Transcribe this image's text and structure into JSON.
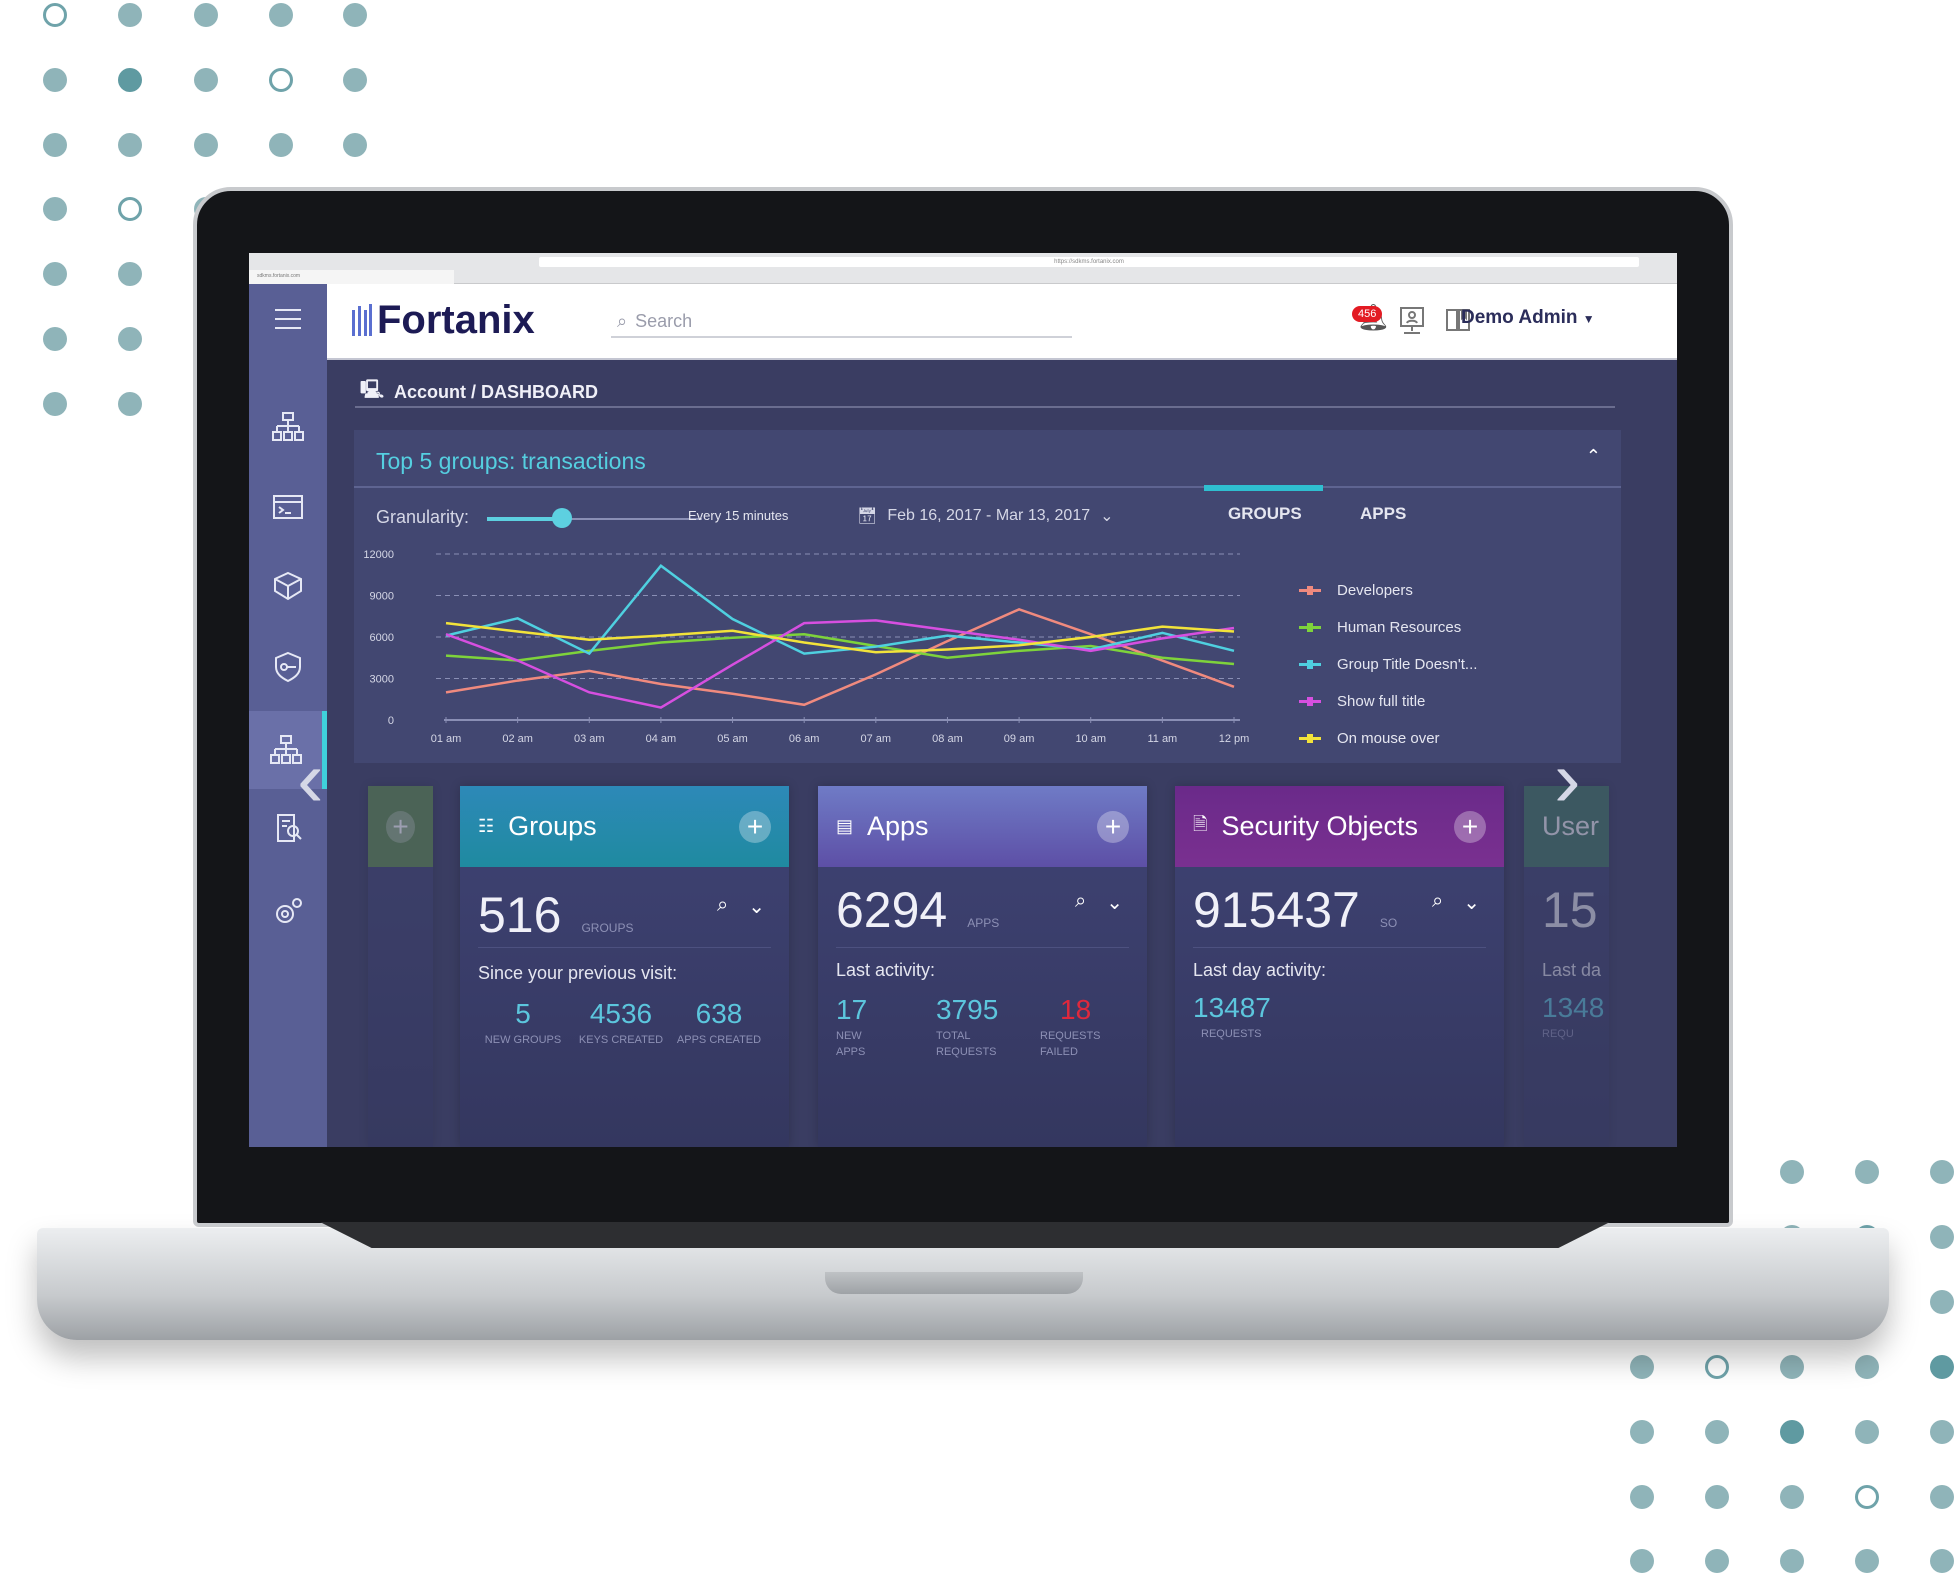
{
  "browser": {
    "url": "https://sdkms.fortanix.com",
    "tab": "sdkms.fortanix.com"
  },
  "header": {
    "logo": "Fortanix",
    "search_placeholder": "Search",
    "notification_count": "456",
    "user": "Demo Admin"
  },
  "sidebar": {
    "items": [
      {
        "icon": "menu-icon"
      },
      {
        "icon": "groups-icon"
      },
      {
        "icon": "apps-icon"
      },
      {
        "icon": "security-objects-icon"
      },
      {
        "icon": "shield-key-icon"
      },
      {
        "icon": "hierarchy-icon",
        "active": true
      },
      {
        "icon": "audit-log-icon"
      },
      {
        "icon": "settings-icon"
      }
    ]
  },
  "breadcrumb": "Account / DASHBOARD",
  "panel": {
    "title": "Top 5 groups: transactions",
    "granularity_label": "Granularity:",
    "granularity_value": "Every 15 minutes",
    "granularity_level": 0.35,
    "date_range": "Feb 16, 2017 - Mar 13, 2017",
    "tabs": [
      {
        "label": "GROUPS",
        "active": true
      },
      {
        "label": "APPS"
      }
    ]
  },
  "chart_data": {
    "type": "line",
    "x": [
      "01 am",
      "02 am",
      "03 am",
      "04 am",
      "05 am",
      "06 am",
      "07 am",
      "08 am",
      "09 am",
      "10 am",
      "11 am",
      "12 pm"
    ],
    "yticks": [
      "12000",
      "9000",
      "6000",
      "3000",
      "0"
    ],
    "ylim": [
      0,
      12000
    ],
    "grid": true,
    "legend": "right",
    "series": [
      {
        "name": "Developers",
        "color": "#f08a7e",
        "values": [
          2000,
          2850,
          3550,
          2600,
          1900,
          1100,
          3300,
          5700,
          8000,
          6200,
          4300,
          2400
        ]
      },
      {
        "name": "Human Resources",
        "color": "#7ed33b",
        "values": [
          4650,
          4300,
          5000,
          5600,
          5950,
          6200,
          5350,
          4500,
          5000,
          5350,
          4500,
          4050
        ]
      },
      {
        "name": "Group Title Doesn't...",
        "color": "#4fd0e0",
        "values": [
          6100,
          7350,
          4800,
          11150,
          7300,
          4800,
          5300,
          6100,
          5600,
          5100,
          6300,
          5000
        ]
      },
      {
        "name": "Show full title",
        "color": "#d64fe0",
        "values": [
          6200,
          4300,
          2000,
          900,
          4000,
          7000,
          7200,
          6500,
          5800,
          5000,
          5900,
          6650
        ]
      },
      {
        "name": "On mouse over",
        "color": "#f2e33a",
        "values": [
          7000,
          6400,
          5800,
          6100,
          6450,
          5600,
          4900,
          5100,
          5400,
          6000,
          6750,
          6400
        ]
      }
    ]
  },
  "cards": {
    "groups": {
      "title": "Groups",
      "count": "516",
      "unit": "GROUPS",
      "subtitle": "Since your previous visit:",
      "stats": [
        {
          "value": "5",
          "label": "NEW GROUPS"
        },
        {
          "value": "4536",
          "label": "KEYS CREATED"
        },
        {
          "value": "638",
          "label": "APPS CREATED"
        }
      ]
    },
    "apps": {
      "title": "Apps",
      "count": "6294",
      "unit": "APPS",
      "subtitle": "Last activity:",
      "stats": [
        {
          "value": "17",
          "label": "NEW APPS"
        },
        {
          "value": "3795",
          "label": "TOTAL REQUESTS"
        },
        {
          "value": "18",
          "label": "REQUESTS FAILED"
        }
      ]
    },
    "security": {
      "title": "Security Objects",
      "count": "915437",
      "unit": "SO",
      "subtitle": "Last day activity:",
      "stats": [
        {
          "value": "13487",
          "label": "REQUESTS"
        }
      ]
    },
    "users": {
      "title": "User",
      "count": "15",
      "subtitle": "Last da",
      "stat": "1348",
      "stat_label": "REQU"
    }
  },
  "colors": {
    "groups_header": "#2a8fb5",
    "apps_header": "#6c6fc0",
    "security_header": "#7a2f8f",
    "accent": "#3fd0db",
    "alert": "#e0283c"
  }
}
